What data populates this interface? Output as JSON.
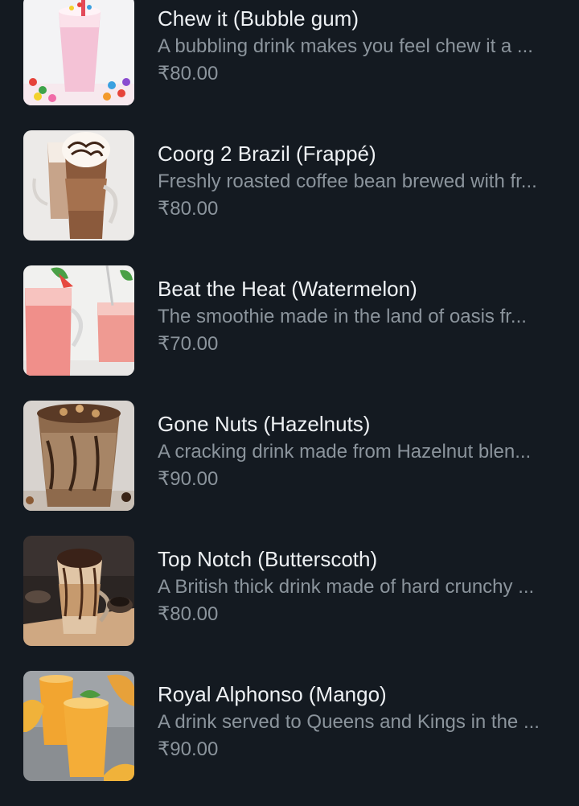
{
  "menu": {
    "items": [
      {
        "name": "Chew it (Bubble gum)",
        "description": "A bubbling drink makes you feel chew it a ...",
        "price": "₹80.00",
        "image": "bubble-gum-shake-image"
      },
      {
        "name": "Coorg 2 Brazil (Frappé)",
        "description": "Freshly roasted coffee bean brewed with fr...",
        "price": "₹80.00",
        "image": "frappe-image"
      },
      {
        "name": "Beat the Heat (Watermelon)",
        "description": "The smoothie made in the land of oasis fr...",
        "price": "₹70.00",
        "image": "watermelon-smoothie-image"
      },
      {
        "name": "Gone Nuts (Hazelnuts)",
        "description": "A cracking drink made from Hazelnut blen...",
        "price": "₹90.00",
        "image": "hazelnut-shake-image"
      },
      {
        "name": "Top Notch (Butterscoth)",
        "description": "A British thick drink made of hard crunchy ...",
        "price": "₹80.00",
        "image": "butterscotch-shake-image"
      },
      {
        "name": "Royal Alphonso (Mango)",
        "description": "A drink served to Queens and Kings in the ...",
        "price": "₹90.00",
        "image": "mango-shake-image"
      }
    ]
  },
  "colors": {
    "background": "#141a21",
    "title": "#eef1f4",
    "secondary_text": "#8b949c"
  }
}
